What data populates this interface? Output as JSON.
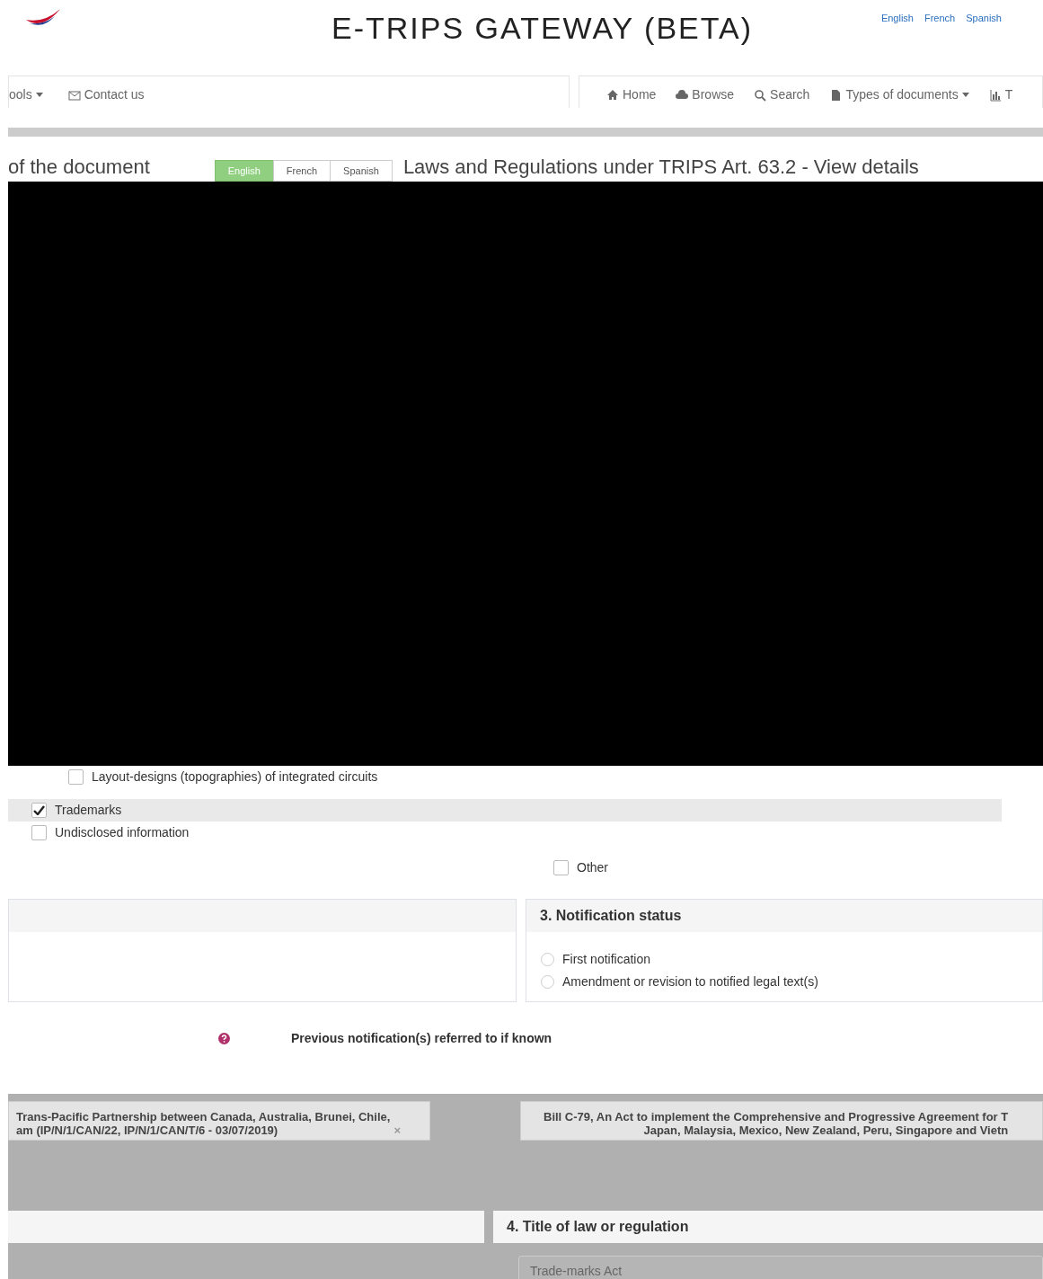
{
  "header": {
    "title": "E-TRIPS GATEWAY (BETA)",
    "languages": [
      {
        "label": "English"
      },
      {
        "label": "French"
      },
      {
        "label": "Spanish"
      }
    ]
  },
  "nav_left": [
    {
      "label": "ools",
      "kind": "dropdown"
    },
    {
      "label": "Contact us",
      "kind": "envelope"
    }
  ],
  "nav_right": [
    {
      "label": "Home",
      "kind": "home"
    },
    {
      "label": "Browse",
      "kind": "cloud"
    },
    {
      "label": "Search",
      "kind": "search"
    },
    {
      "label": "Types of documents",
      "kind": "document"
    },
    {
      "label": "T",
      "kind": "chart"
    }
  ],
  "doc_bar": {
    "label": "of the document",
    "languages": [
      {
        "label": "English",
        "selected": true
      },
      {
        "label": "French",
        "selected": false
      },
      {
        "label": "Spanish",
        "selected": false
      }
    ],
    "title": "Laws and Regulations under TRIPS Art. 63.2 - View details"
  },
  "subjects_left": [
    {
      "label": "Layout-designs (topographies) of integrated circuits",
      "checked": false
    },
    {
      "label": "Trademarks",
      "checked": true
    },
    {
      "label": "Undisclosed information",
      "checked": false
    }
  ],
  "subjects_right": [
    {
      "label": "Other",
      "checked": false
    }
  ],
  "notification_status": {
    "title": "3. Notification status",
    "options": [
      {
        "label": "First notification",
        "selected": false
      },
      {
        "label": "Amendment or revision to notified legal text(s)",
        "selected": false
      }
    ]
  },
  "previous": {
    "label": "Previous notification(s) referred to if known",
    "tags": [
      {
        "text": "Trans-Pacific Partnership between Canada, Australia, Brunei, Chile,\nam (IP/N/1/CAN/22, IP/N/1/CAN/T/6 - 03/07/2019)",
        "remove_icon": "×"
      },
      {
        "text": "Bill C-79, An Act to implement the Comprehensive and Progressive Agreement for T\nJapan, Malaysia, Mexico, New Zealand, Peru, Singapore and Vietn"
      }
    ]
  },
  "title_section": {
    "title": "4. Title of law or regulation",
    "value": "Trade-marks Act"
  }
}
